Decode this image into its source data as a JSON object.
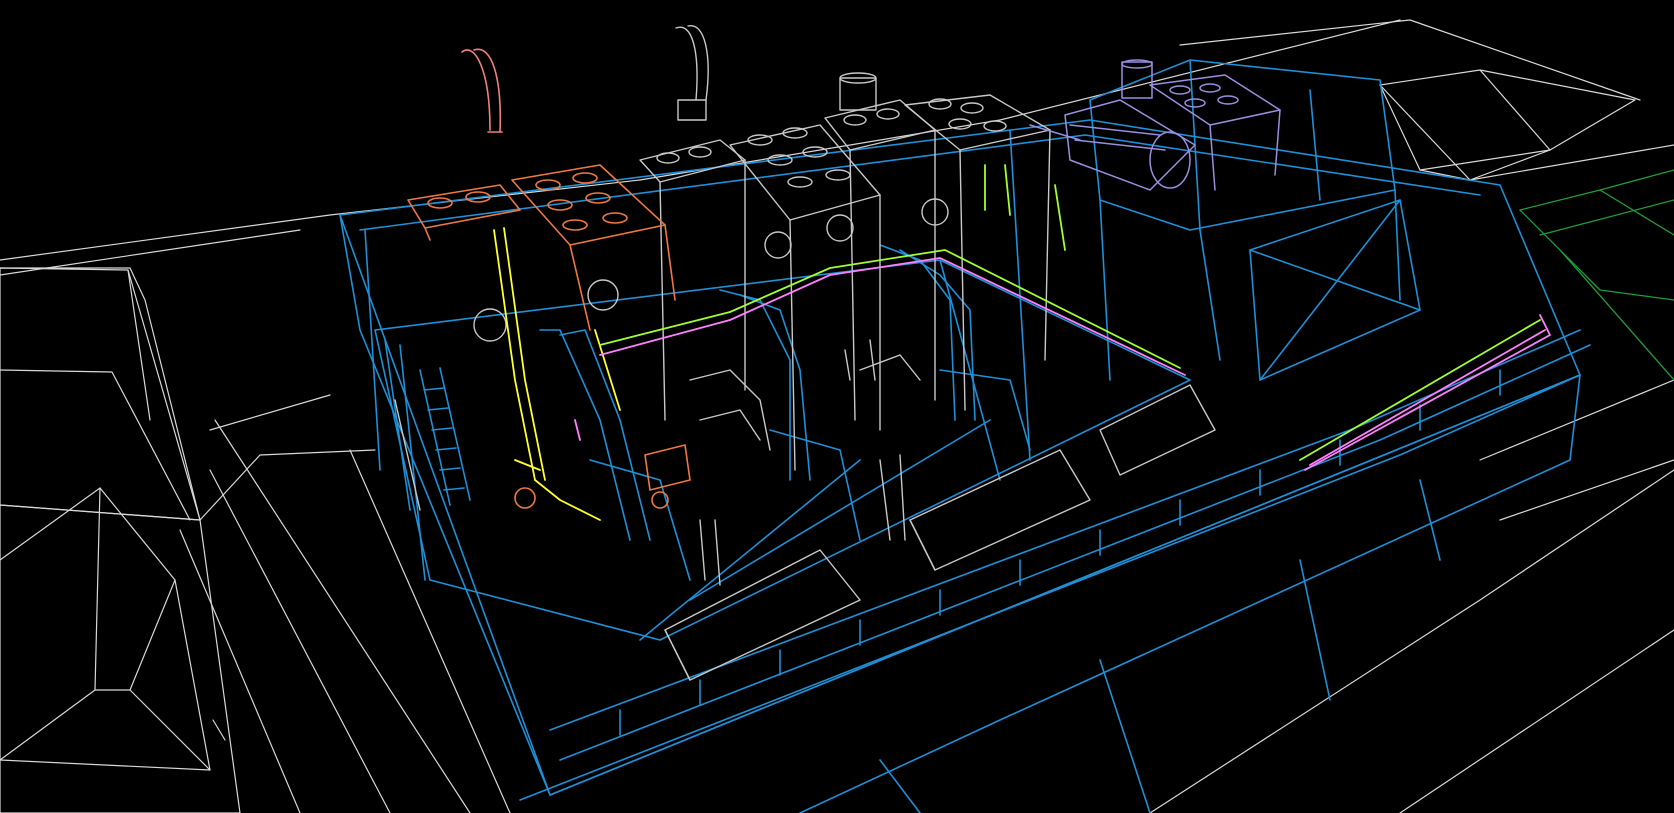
{
  "viewport": {
    "background": "#000000",
    "render_mode": "wireframe"
  },
  "palette": {
    "context": "#d8d8d8",
    "structure": "#1e90d8",
    "equipment_grey": "#c8c8c8",
    "equipment_orange": "#f07840",
    "exhaust_pink": "#f08080",
    "pipe_yellow": "#ffff30",
    "pipe_magenta": "#ff80ff",
    "pipe_lime": "#a0ff30",
    "equipment_violet": "#9a8ee0",
    "neighbor_green": "#1f9e3a"
  },
  "layers": [
    {
      "id": "context-buildings",
      "color_key": "context"
    },
    {
      "id": "neighbor-building",
      "color_key": "neighbor_green"
    },
    {
      "id": "building-structure",
      "color_key": "structure"
    },
    {
      "id": "generator-units-grey",
      "color_key": "equipment_grey"
    },
    {
      "id": "generator-unit-orange",
      "color_key": "equipment_orange"
    },
    {
      "id": "exhaust-stack-pink",
      "color_key": "exhaust_pink"
    },
    {
      "id": "pipework-yellow",
      "color_key": "pipe_yellow"
    },
    {
      "id": "pipework-magenta",
      "color_key": "pipe_magenta"
    },
    {
      "id": "pipework-lime",
      "color_key": "pipe_lime"
    },
    {
      "id": "hvac-unit-violet",
      "color_key": "equipment_violet"
    }
  ]
}
